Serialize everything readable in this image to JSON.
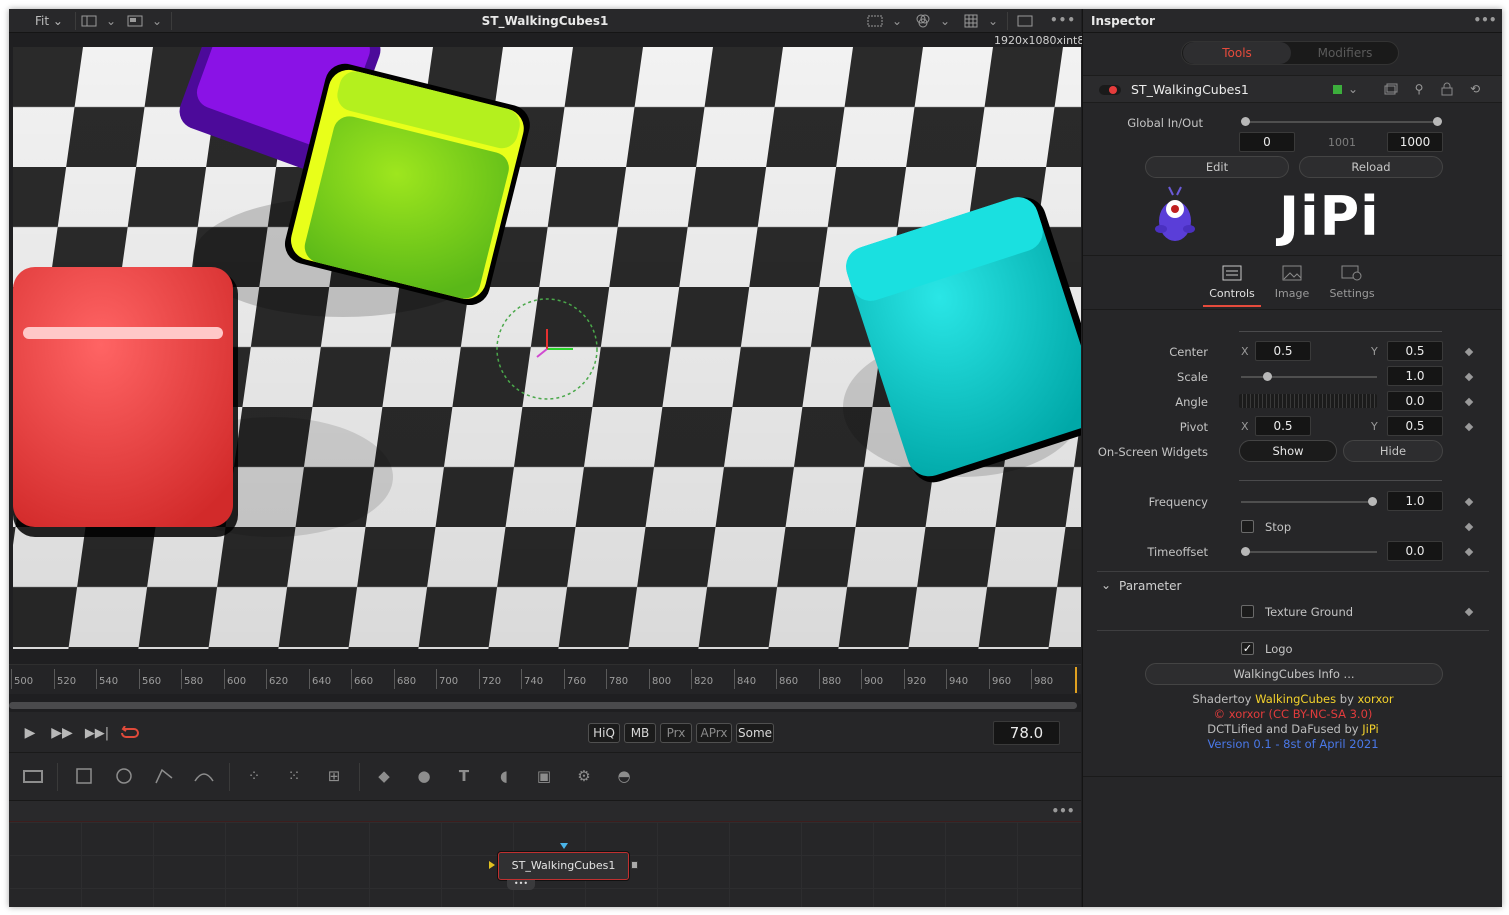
{
  "viewer": {
    "fit_label": "Fit",
    "title": "ST_WalkingCubes1",
    "resolution": "1920x1080xint8",
    "menu_icon": "more-icon"
  },
  "timeline": {
    "ruler_labels": [
      "500",
      "520",
      "540",
      "560",
      "580",
      "600",
      "620",
      "640",
      "660",
      "680",
      "700",
      "720",
      "740",
      "760",
      "780",
      "800",
      "820",
      "840",
      "860",
      "880",
      "900",
      "920",
      "940",
      "960",
      "980"
    ],
    "buttons": [
      "HiQ",
      "MB",
      "Prx",
      "APrx",
      "Some"
    ],
    "current_frame": "78.0"
  },
  "node_editor": {
    "node_label": "ST_WalkingCubes1"
  },
  "inspector": {
    "title": "Inspector",
    "tabs": [
      "Tools",
      "Modifiers"
    ],
    "tool_name": "ST_WalkingCubes1",
    "global_label": "Global In/Out",
    "global_in": "0",
    "global_mid": "1001",
    "global_out": "1000",
    "edit_label": "Edit",
    "reload_label": "Reload",
    "logo_text": "JiPi",
    "subtabs": [
      "Controls",
      "Image",
      "Settings"
    ],
    "center_label": "Center",
    "x_label": "X",
    "y_label": "Y",
    "center_x": "0.5",
    "center_y": "0.5",
    "scale_label": "Scale",
    "scale_value": "1.0",
    "angle_label": "Angle",
    "angle_value": "0.0",
    "pivot_label": "Pivot",
    "pivot_x": "0.5",
    "pivot_y": "0.5",
    "widgets_label": "On-Screen Widgets",
    "show_label": "Show",
    "hide_label": "Hide",
    "frequency_label": "Frequency",
    "frequency_value": "1.0",
    "stop_label": "Stop",
    "timeoffset_label": "Timeoffset",
    "timeoffset_value": "0.0",
    "parameter_label": "Parameter",
    "texture_label": "Texture Ground",
    "logo_label": "Logo",
    "info_button": "WalkingCubes Info ...",
    "credit1_a": "Shadertoy ",
    "credit1_b": "WalkingCubes",
    "credit1_c": " by ",
    "credit1_d": "xorxor",
    "credit2": "© xorxor (CC BY-NC-SA 3.0)",
    "credit3_a": "DCTLified and DaFused by ",
    "credit3_b": "JiPi",
    "credit4": "Version 0.1 - 8st of April 2021"
  },
  "colors": {
    "accent_red": "#e64b3c",
    "credit_yellow": "#f2d12c",
    "credit_red": "#e13c3c",
    "credit_blue": "#4a78e8"
  }
}
